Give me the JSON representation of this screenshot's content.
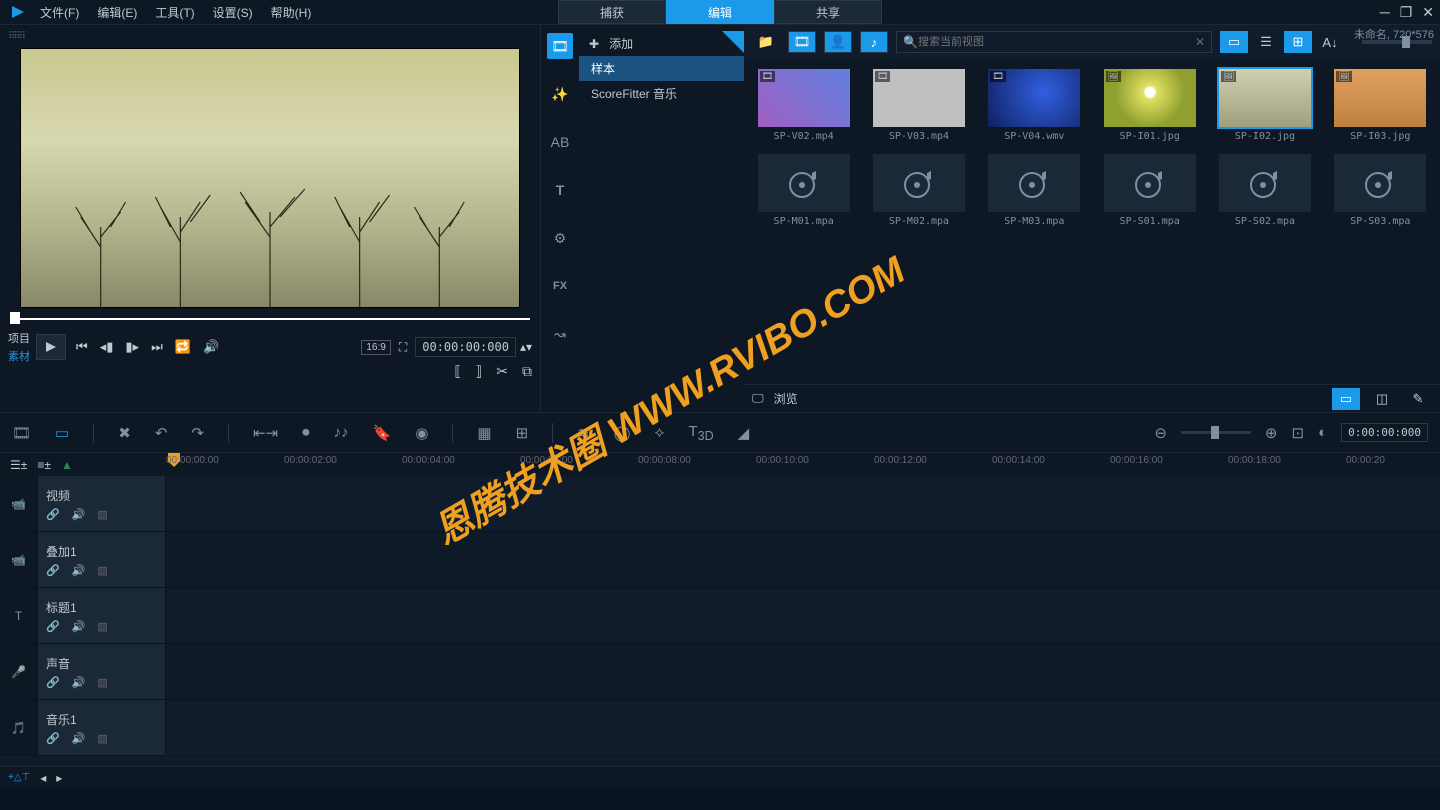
{
  "menus": {
    "file": "文件(F)",
    "edit": "编辑(E)",
    "tools": "工具(T)",
    "settings": "设置(S)",
    "help": "帮助(H)"
  },
  "tabs": {
    "capture": "捕获",
    "edit": "编辑",
    "share": "共享"
  },
  "status": "未命名, 720*576",
  "preview": {
    "project": "项目",
    "clip": "素材",
    "aspect": "16:9",
    "timecode": "00:00:00:000"
  },
  "lib": {
    "add": "添加",
    "sample": "样本",
    "scorefitter": "ScoreFitter 音乐",
    "search_placeholder": "搜索当前视图",
    "browse": "浏览",
    "items": [
      {
        "name": "SP-V02.mp4",
        "type": "video"
      },
      {
        "name": "SP-V03.mp4",
        "type": "video"
      },
      {
        "name": "SP-V04.wmv",
        "type": "video"
      },
      {
        "name": "SP-I01.jpg",
        "type": "image"
      },
      {
        "name": "SP-I02.jpg",
        "type": "image",
        "selected": true
      },
      {
        "name": "SP-I03.jpg",
        "type": "image"
      },
      {
        "name": "SP-M01.mpa",
        "type": "audio"
      },
      {
        "name": "SP-M02.mpa",
        "type": "audio"
      },
      {
        "name": "SP-M03.mpa",
        "type": "audio"
      },
      {
        "name": "SP-S01.mpa",
        "type": "audio"
      },
      {
        "name": "SP-S02.mpa",
        "type": "audio"
      },
      {
        "name": "SP-S03.mpa",
        "type": "audio"
      }
    ]
  },
  "timeline": {
    "timecode": "0:00:00:000",
    "ruler": [
      "00:00:00:00",
      "00:00:02:00",
      "00:00:04:00",
      "00:00:06:00",
      "00:00:08:00",
      "00:00:10:00",
      "00:00:12:00",
      "00:00:14:00",
      "00:00:16:00",
      "00:00:18:00",
      "00:00:20"
    ],
    "tracks": [
      {
        "label": "视频",
        "icon": "📹"
      },
      {
        "label": "叠加1",
        "icon": "📹"
      },
      {
        "label": "标题1",
        "icon": "T"
      },
      {
        "label": "声音",
        "icon": "🎤"
      },
      {
        "label": "音乐1",
        "icon": "🎵"
      }
    ]
  },
  "watermark": "恩腾技术圈 WWW.RVIBO.COM"
}
